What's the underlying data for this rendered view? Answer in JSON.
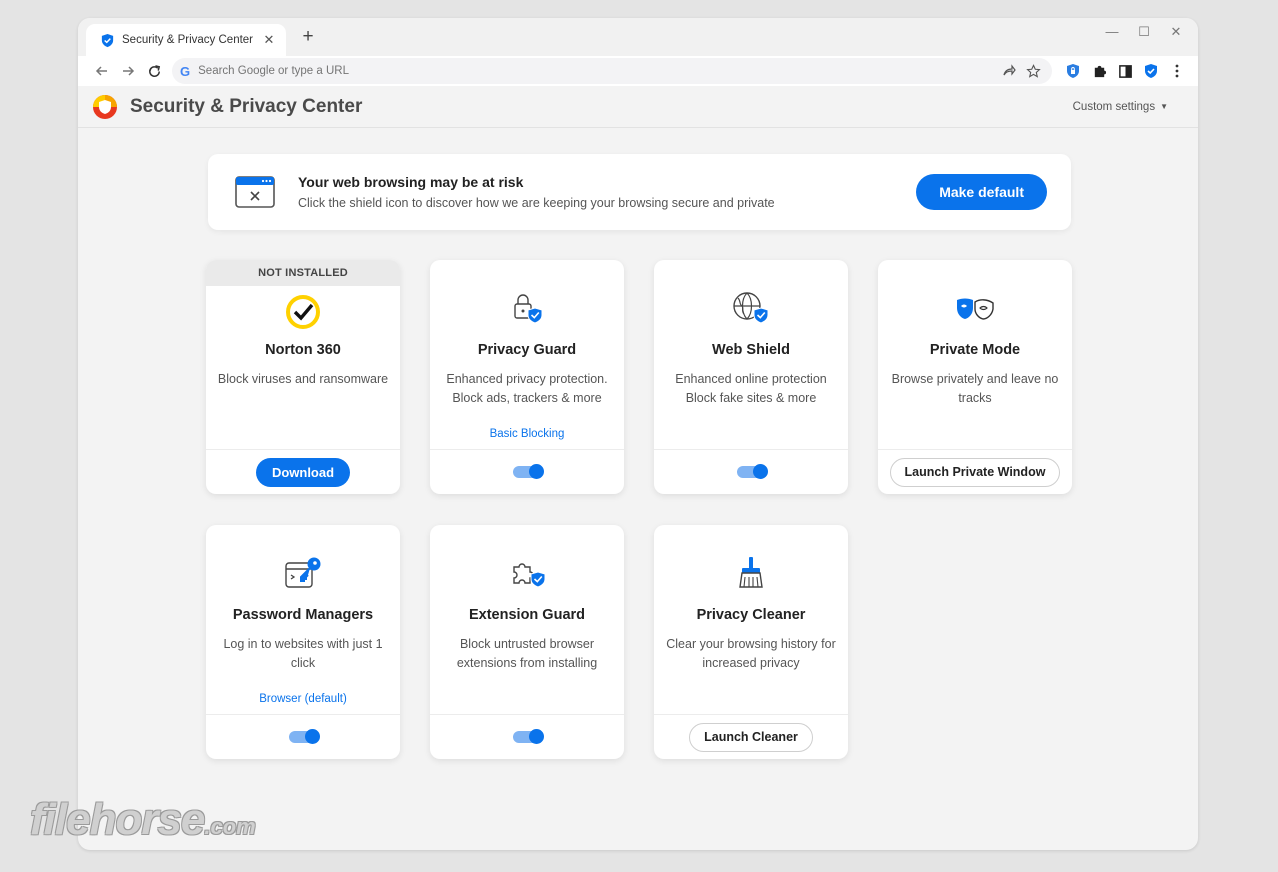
{
  "browser": {
    "tab_title": "Security & Privacy Center",
    "tab_close": "✕",
    "new_tab": "+",
    "window_controls": {
      "minimize": "—",
      "maximize": "☐",
      "close": "✕"
    },
    "omnibox_placeholder": "Search Google or type a URL",
    "google_glyph": "G"
  },
  "app": {
    "title": "Security & Privacy Center",
    "custom_settings": "Custom settings",
    "caret": "▼"
  },
  "banner": {
    "heading": "Your web browsing may be at risk",
    "subtext": "Click the shield icon to discover how we are keeping your browsing secure and private",
    "button": "Make default"
  },
  "cards": {
    "norton": {
      "badge": "NOT INSTALLED",
      "title": "Norton 360",
      "desc": "Block viruses and ransomware",
      "button": "Download",
      "icon": "norton-check-icon"
    },
    "privacy_guard": {
      "title": "Privacy Guard",
      "desc": "Enhanced privacy protection. Block ads, trackers & more",
      "link": "Basic Blocking",
      "enabled": true,
      "icon": "lock-shield-icon"
    },
    "web_shield": {
      "title": "Web Shield",
      "desc": "Enhanced online protection Block fake sites & more",
      "enabled": true,
      "icon": "globe-shield-icon"
    },
    "private_mode": {
      "title": "Private Mode",
      "desc": "Browse privately and leave no tracks",
      "button": "Launch Private Window",
      "icon": "mask-icon"
    },
    "password_managers": {
      "title": "Password Managers",
      "desc": "Log in to websites with just 1 click",
      "link": "Browser (default)",
      "enabled": true,
      "icon": "key-window-icon"
    },
    "extension_guard": {
      "title": "Extension Guard",
      "desc": "Block untrusted browser extensions from installing",
      "enabled": true,
      "icon": "puzzle-shield-icon"
    },
    "privacy_cleaner": {
      "title": "Privacy Cleaner",
      "desc": "Clear your browsing history for increased privacy",
      "button": "Launch Cleaner",
      "icon": "broom-icon"
    }
  },
  "colors": {
    "accent": "#0a73eb",
    "toggle_track": "#7fb3f3",
    "norton_yellow": "#ffd100"
  },
  "watermark": {
    "main": "filehorse",
    "domain": ".com"
  }
}
